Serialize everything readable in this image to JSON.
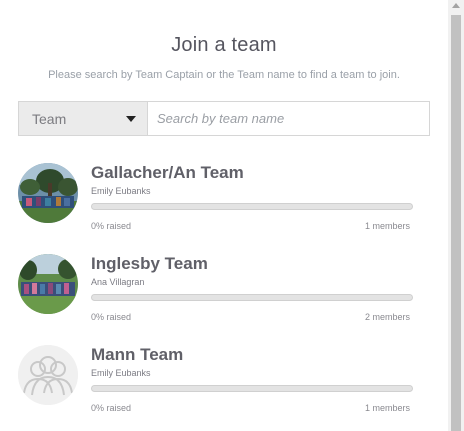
{
  "header": {
    "title": "Join a team",
    "subtitle": "Please search by Team Captain or the Team name to find a team to join."
  },
  "search": {
    "filter_value": "Team",
    "placeholder": "Search by team name",
    "value": ""
  },
  "teams": [
    {
      "name": "Gallacher/An Team",
      "captain": "Emily Eubanks",
      "raised_text": "0% raised",
      "raised_fraction": 0,
      "members_text": "1 members",
      "avatar": "photo"
    },
    {
      "name": "Inglesby Team",
      "captain": "Ana Villagran",
      "raised_text": "0% raised",
      "raised_fraction": 0,
      "members_text": "2 members",
      "avatar": "photo"
    },
    {
      "name": "Mann Team",
      "captain": "Emily Eubanks",
      "raised_text": "0% raised",
      "raised_fraction": 0,
      "members_text": "1 members",
      "avatar": "group-placeholder-icon"
    }
  ],
  "colors": {
    "progress_fill": "#7ab55c",
    "progress_track": "#e3e3e3"
  }
}
